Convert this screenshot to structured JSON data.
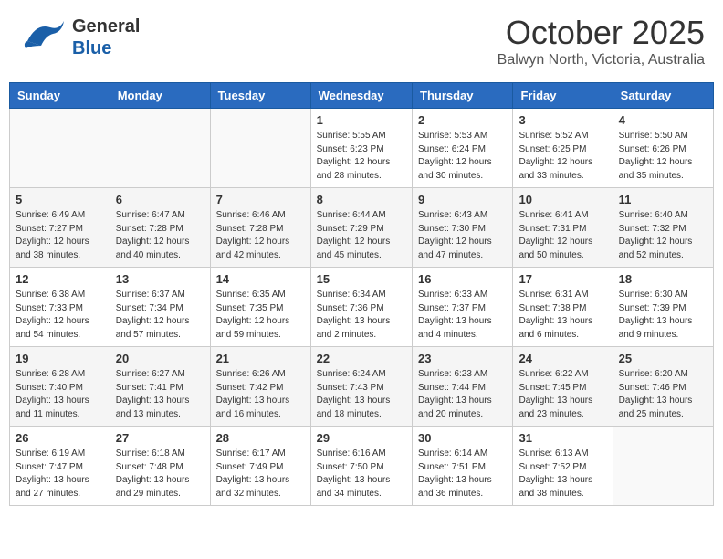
{
  "header": {
    "logo_line1": "General",
    "logo_line2": "Blue",
    "month_title": "October 2025",
    "subtitle": "Balwyn North, Victoria, Australia"
  },
  "days_of_week": [
    "Sunday",
    "Monday",
    "Tuesday",
    "Wednesday",
    "Thursday",
    "Friday",
    "Saturday"
  ],
  "weeks": [
    [
      {
        "day": "",
        "info": ""
      },
      {
        "day": "",
        "info": ""
      },
      {
        "day": "",
        "info": ""
      },
      {
        "day": "1",
        "info": "Sunrise: 5:55 AM\nSunset: 6:23 PM\nDaylight: 12 hours and 28 minutes."
      },
      {
        "day": "2",
        "info": "Sunrise: 5:53 AM\nSunset: 6:24 PM\nDaylight: 12 hours and 30 minutes."
      },
      {
        "day": "3",
        "info": "Sunrise: 5:52 AM\nSunset: 6:25 PM\nDaylight: 12 hours and 33 minutes."
      },
      {
        "day": "4",
        "info": "Sunrise: 5:50 AM\nSunset: 6:26 PM\nDaylight: 12 hours and 35 minutes."
      }
    ],
    [
      {
        "day": "5",
        "info": "Sunrise: 6:49 AM\nSunset: 7:27 PM\nDaylight: 12 hours and 38 minutes."
      },
      {
        "day": "6",
        "info": "Sunrise: 6:47 AM\nSunset: 7:28 PM\nDaylight: 12 hours and 40 minutes."
      },
      {
        "day": "7",
        "info": "Sunrise: 6:46 AM\nSunset: 7:28 PM\nDaylight: 12 hours and 42 minutes."
      },
      {
        "day": "8",
        "info": "Sunrise: 6:44 AM\nSunset: 7:29 PM\nDaylight: 12 hours and 45 minutes."
      },
      {
        "day": "9",
        "info": "Sunrise: 6:43 AM\nSunset: 7:30 PM\nDaylight: 12 hours and 47 minutes."
      },
      {
        "day": "10",
        "info": "Sunrise: 6:41 AM\nSunset: 7:31 PM\nDaylight: 12 hours and 50 minutes."
      },
      {
        "day": "11",
        "info": "Sunrise: 6:40 AM\nSunset: 7:32 PM\nDaylight: 12 hours and 52 minutes."
      }
    ],
    [
      {
        "day": "12",
        "info": "Sunrise: 6:38 AM\nSunset: 7:33 PM\nDaylight: 12 hours and 54 minutes."
      },
      {
        "day": "13",
        "info": "Sunrise: 6:37 AM\nSunset: 7:34 PM\nDaylight: 12 hours and 57 minutes."
      },
      {
        "day": "14",
        "info": "Sunrise: 6:35 AM\nSunset: 7:35 PM\nDaylight: 12 hours and 59 minutes."
      },
      {
        "day": "15",
        "info": "Sunrise: 6:34 AM\nSunset: 7:36 PM\nDaylight: 13 hours and 2 minutes."
      },
      {
        "day": "16",
        "info": "Sunrise: 6:33 AM\nSunset: 7:37 PM\nDaylight: 13 hours and 4 minutes."
      },
      {
        "day": "17",
        "info": "Sunrise: 6:31 AM\nSunset: 7:38 PM\nDaylight: 13 hours and 6 minutes."
      },
      {
        "day": "18",
        "info": "Sunrise: 6:30 AM\nSunset: 7:39 PM\nDaylight: 13 hours and 9 minutes."
      }
    ],
    [
      {
        "day": "19",
        "info": "Sunrise: 6:28 AM\nSunset: 7:40 PM\nDaylight: 13 hours and 11 minutes."
      },
      {
        "day": "20",
        "info": "Sunrise: 6:27 AM\nSunset: 7:41 PM\nDaylight: 13 hours and 13 minutes."
      },
      {
        "day": "21",
        "info": "Sunrise: 6:26 AM\nSunset: 7:42 PM\nDaylight: 13 hours and 16 minutes."
      },
      {
        "day": "22",
        "info": "Sunrise: 6:24 AM\nSunset: 7:43 PM\nDaylight: 13 hours and 18 minutes."
      },
      {
        "day": "23",
        "info": "Sunrise: 6:23 AM\nSunset: 7:44 PM\nDaylight: 13 hours and 20 minutes."
      },
      {
        "day": "24",
        "info": "Sunrise: 6:22 AM\nSunset: 7:45 PM\nDaylight: 13 hours and 23 minutes."
      },
      {
        "day": "25",
        "info": "Sunrise: 6:20 AM\nSunset: 7:46 PM\nDaylight: 13 hours and 25 minutes."
      }
    ],
    [
      {
        "day": "26",
        "info": "Sunrise: 6:19 AM\nSunset: 7:47 PM\nDaylight: 13 hours and 27 minutes."
      },
      {
        "day": "27",
        "info": "Sunrise: 6:18 AM\nSunset: 7:48 PM\nDaylight: 13 hours and 29 minutes."
      },
      {
        "day": "28",
        "info": "Sunrise: 6:17 AM\nSunset: 7:49 PM\nDaylight: 13 hours and 32 minutes."
      },
      {
        "day": "29",
        "info": "Sunrise: 6:16 AM\nSunset: 7:50 PM\nDaylight: 13 hours and 34 minutes."
      },
      {
        "day": "30",
        "info": "Sunrise: 6:14 AM\nSunset: 7:51 PM\nDaylight: 13 hours and 36 minutes."
      },
      {
        "day": "31",
        "info": "Sunrise: 6:13 AM\nSunset: 7:52 PM\nDaylight: 13 hours and 38 minutes."
      },
      {
        "day": "",
        "info": ""
      }
    ]
  ]
}
